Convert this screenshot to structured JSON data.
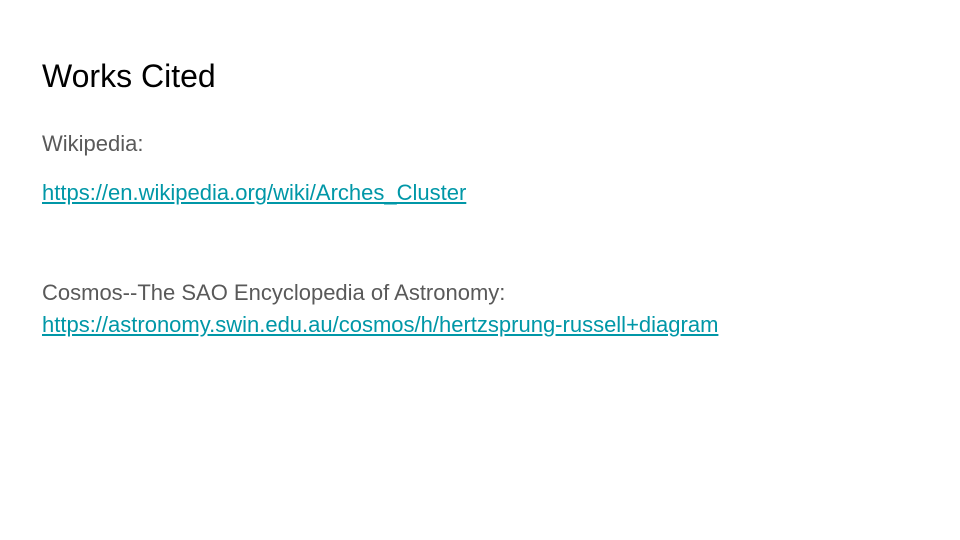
{
  "slide": {
    "title": "Works Cited",
    "sources": [
      {
        "label": "Wikipedia:",
        "url": "https://en.wikipedia.org/wiki/Arches_Cluster"
      },
      {
        "label": "Cosmos--The SAO Encyclopedia of Astronomy:",
        "url": "https://astronomy.swin.edu.au/cosmos/h/hertzsprung-russell+diagram"
      }
    ]
  },
  "colors": {
    "title": "#000000",
    "body": "#595959",
    "link": "#0097a7",
    "background": "#ffffff"
  }
}
